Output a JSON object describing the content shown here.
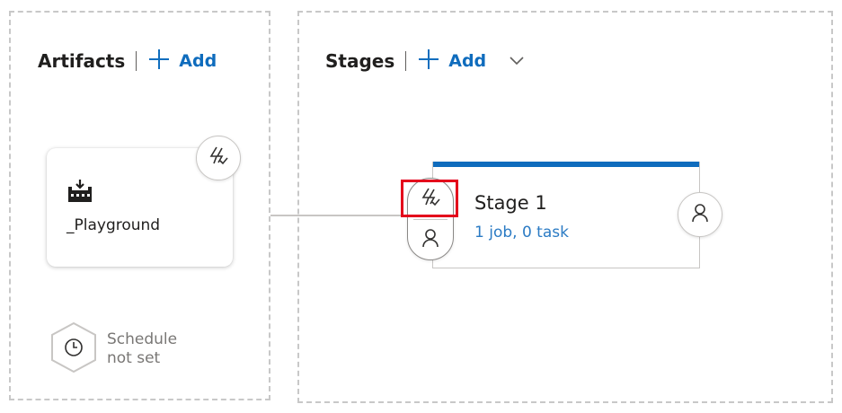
{
  "artifacts": {
    "title": "Artifacts",
    "add_label": "Add",
    "card": {
      "name": "_Playground",
      "icon": "build-artifact-icon"
    },
    "trigger_icon": "continuous-deployment-trigger-icon",
    "schedule": {
      "line1": "Schedule",
      "line2": "not set",
      "icon": "clock-icon"
    }
  },
  "stages": {
    "title": "Stages",
    "add_label": "Add",
    "stage": {
      "name": "Stage 1",
      "meta": "1 job, 0 task"
    },
    "pre_deployment": {
      "trigger_icon": "lightning-icon",
      "approval_icon": "person-icon"
    },
    "post_deployment": {
      "approval_icon": "person-icon"
    }
  },
  "colors": {
    "accent": "#0f6cbd",
    "link": "#2b7bc4",
    "highlight": "#e4001b",
    "border": "#c8c6c4"
  }
}
